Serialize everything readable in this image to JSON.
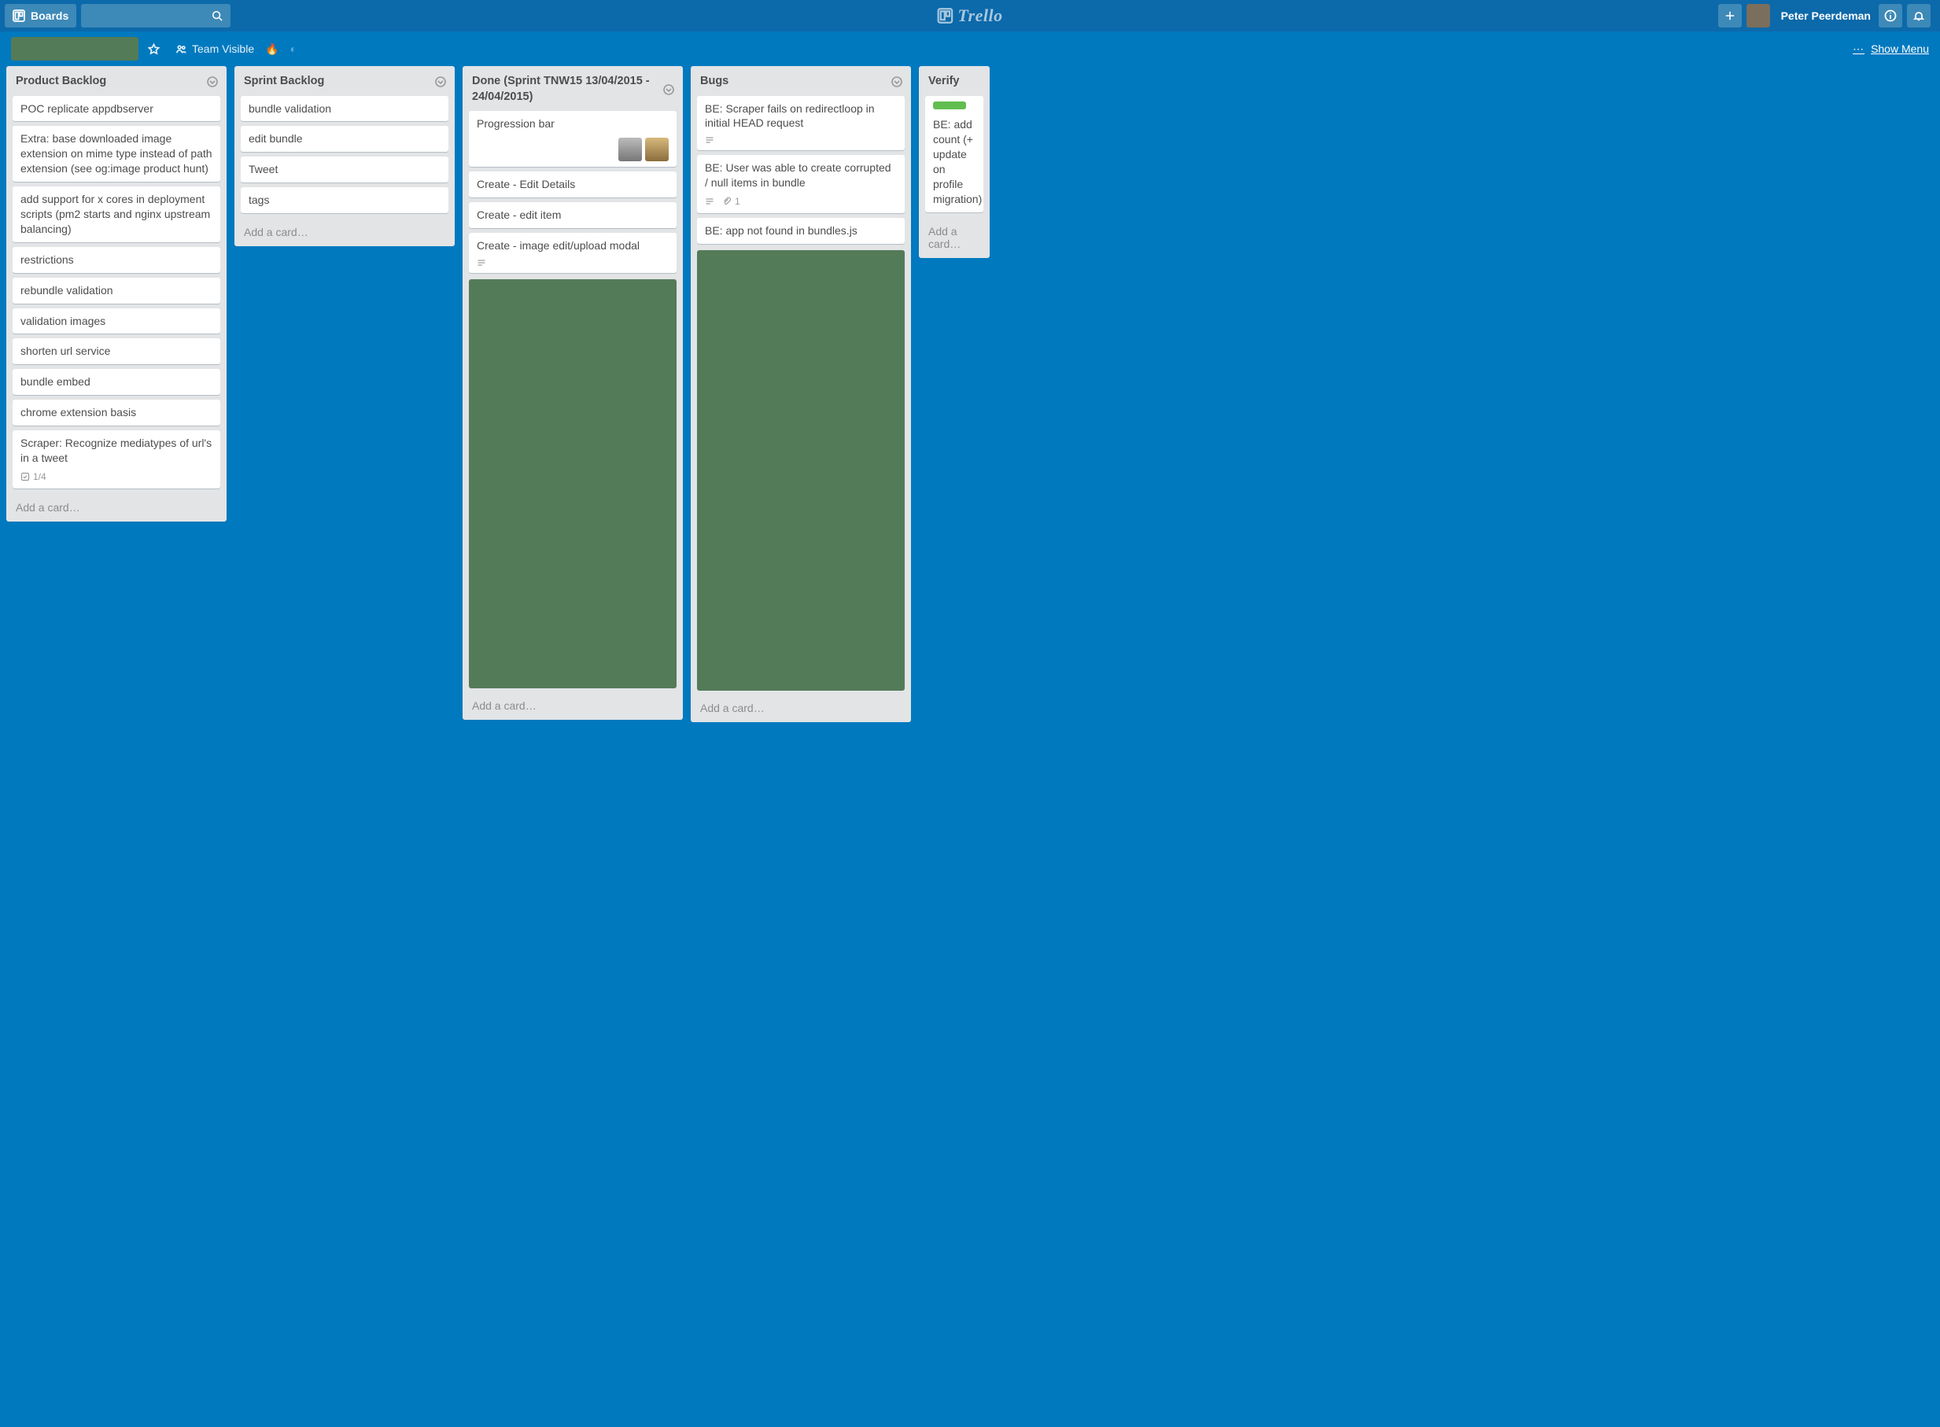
{
  "header": {
    "boards_label": "Boards",
    "app_name": "Trello",
    "user_name": "Peter Peerdeman"
  },
  "board_header": {
    "visibility": "Team Visible",
    "fire_emoji": "🔥",
    "show_menu": "Show Menu"
  },
  "lists": [
    {
      "title": "Product Backlog",
      "add": "Add a card…",
      "cards": [
        {
          "text": "POC replicate appdbserver"
        },
        {
          "text": "Extra: base downloaded image extension on mime type instead of path extension (see og:image product hunt)"
        },
        {
          "text": "add support for x cores in deployment scripts (pm2 starts and nginx upstream balancing)"
        },
        {
          "text": "restrictions"
        },
        {
          "text": "rebundle validation"
        },
        {
          "text": "validation images"
        },
        {
          "text": "shorten url service"
        },
        {
          "text": "bundle embed"
        },
        {
          "text": "chrome extension basis"
        },
        {
          "text": "Scraper: Recognize mediatypes of url's in a tweet",
          "checklist": "1/4"
        }
      ]
    },
    {
      "title": "Sprint Backlog",
      "add": "Add a card…",
      "cards": [
        {
          "text": "bundle validation"
        },
        {
          "text": "edit bundle"
        },
        {
          "text": "Tweet"
        },
        {
          "text": "tags"
        }
      ]
    },
    {
      "title": "Done (Sprint TNW15 13/04/2015 - 24/04/2015)",
      "add": "Add a card…",
      "cards": [
        {
          "text": "Progression bar",
          "members": 2
        },
        {
          "text": "Create - Edit Details"
        },
        {
          "text": "Create - edit item"
        },
        {
          "text": "Create - image edit/upload modal",
          "description": true
        }
      ]
    },
    {
      "title": "Bugs",
      "add": "Add a card…",
      "cards": [
        {
          "text": "BE: Scraper fails on redirectloop in initial HEAD request",
          "description": true
        },
        {
          "text": "BE: User was able to create corrupted / null items in bundle",
          "description": true,
          "attachments": "1"
        },
        {
          "text": "BE: app not found in bundles.js"
        }
      ]
    },
    {
      "title": "Verify",
      "add": "Add a card…",
      "cards": [
        {
          "text": "BE: add count (+ update on profile migration)",
          "green_label": true
        }
      ]
    }
  ]
}
